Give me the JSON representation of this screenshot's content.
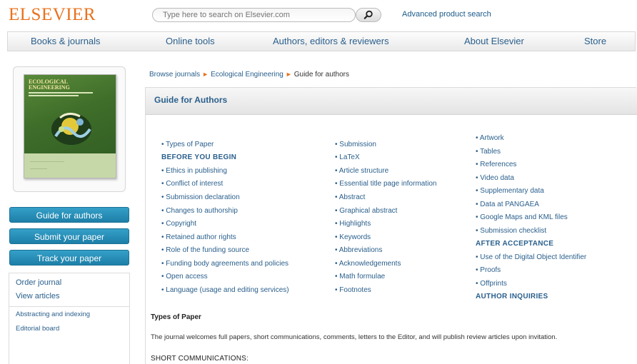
{
  "header": {
    "logo": "ELSEVIER",
    "search_placeholder": "Type here to search on Elsevier.com",
    "advanced_search": "Advanced product search"
  },
  "nav": {
    "items": [
      "Books & journals",
      "Online tools",
      "Authors, editors & reviewers",
      "About Elsevier",
      "Store"
    ]
  },
  "cover": {
    "title_line1": "ECOLOGICAL",
    "title_line2": "ENGINEERING"
  },
  "sidebar": {
    "buttons": [
      "Guide for authors",
      "Submit your paper",
      "Track your paper"
    ],
    "links": [
      "Order journal",
      "View articles",
      "Abstracting and indexing",
      "Editorial board"
    ]
  },
  "breadcrumb": {
    "items": [
      "Browse journals",
      "Ecological Engineering",
      "Guide for authors"
    ],
    "separator": "►"
  },
  "guide": {
    "title": "Guide for Authors",
    "col1": [
      {
        "text": "• Types of Paper",
        "head": false
      },
      {
        "text": "BEFORE YOU BEGIN",
        "head": true
      },
      {
        "text": "• Ethics in publishing",
        "head": false
      },
      {
        "text": "• Conflict of interest",
        "head": false
      },
      {
        "text": "• Submission declaration",
        "head": false
      },
      {
        "text": "• Changes to authorship",
        "head": false
      },
      {
        "text": "• Copyright",
        "head": false
      },
      {
        "text": "• Retained author rights",
        "head": false
      },
      {
        "text": "• Role of the funding source",
        "head": false
      },
      {
        "text": "• Funding body agreements and policies",
        "head": false
      },
      {
        "text": "• Open access",
        "head": false
      },
      {
        "text": "• Language (usage and editing services)",
        "head": false
      }
    ],
    "col2": [
      {
        "text": "• Submission",
        "head": false
      },
      {
        "text": "• LaTeX",
        "head": false
      },
      {
        "text": "• Article structure",
        "head": false
      },
      {
        "text": "• Essential title page information",
        "head": false
      },
      {
        "text": "• Abstract",
        "head": false
      },
      {
        "text": "• Graphical abstract",
        "head": false
      },
      {
        "text": "• Highlights",
        "head": false
      },
      {
        "text": "• Keywords",
        "head": false
      },
      {
        "text": "• Abbreviations",
        "head": false
      },
      {
        "text": "• Acknowledgements",
        "head": false
      },
      {
        "text": "• Math formulae",
        "head": false
      },
      {
        "text": "• Footnotes",
        "head": false
      }
    ],
    "col3": [
      {
        "text": "• Artwork",
        "head": false
      },
      {
        "text": "• Tables",
        "head": false
      },
      {
        "text": "• References",
        "head": false
      },
      {
        "text": "• Video data",
        "head": false
      },
      {
        "text": "• Supplementary data",
        "head": false
      },
      {
        "text": "• Data at PANGAEA",
        "head": false
      },
      {
        "text": "• Google Maps and KML files",
        "head": false
      },
      {
        "text": "• Submission checklist",
        "head": false
      },
      {
        "text": "AFTER ACCEPTANCE",
        "head": true
      },
      {
        "text": "• Use of the Digital Object Identifier",
        "head": false
      },
      {
        "text": "• Proofs",
        "head": false
      },
      {
        "text": "• Offprints",
        "head": false
      },
      {
        "text": "AUTHOR INQUIRIES",
        "head": true
      }
    ]
  },
  "content": {
    "section_title": "Types of Paper",
    "body": "The journal welcomes full papers, short communications, comments, letters to the Editor, and will publish review articles upon invitation.",
    "short_comm": "SHORT COMMUNICATIONS:"
  }
}
